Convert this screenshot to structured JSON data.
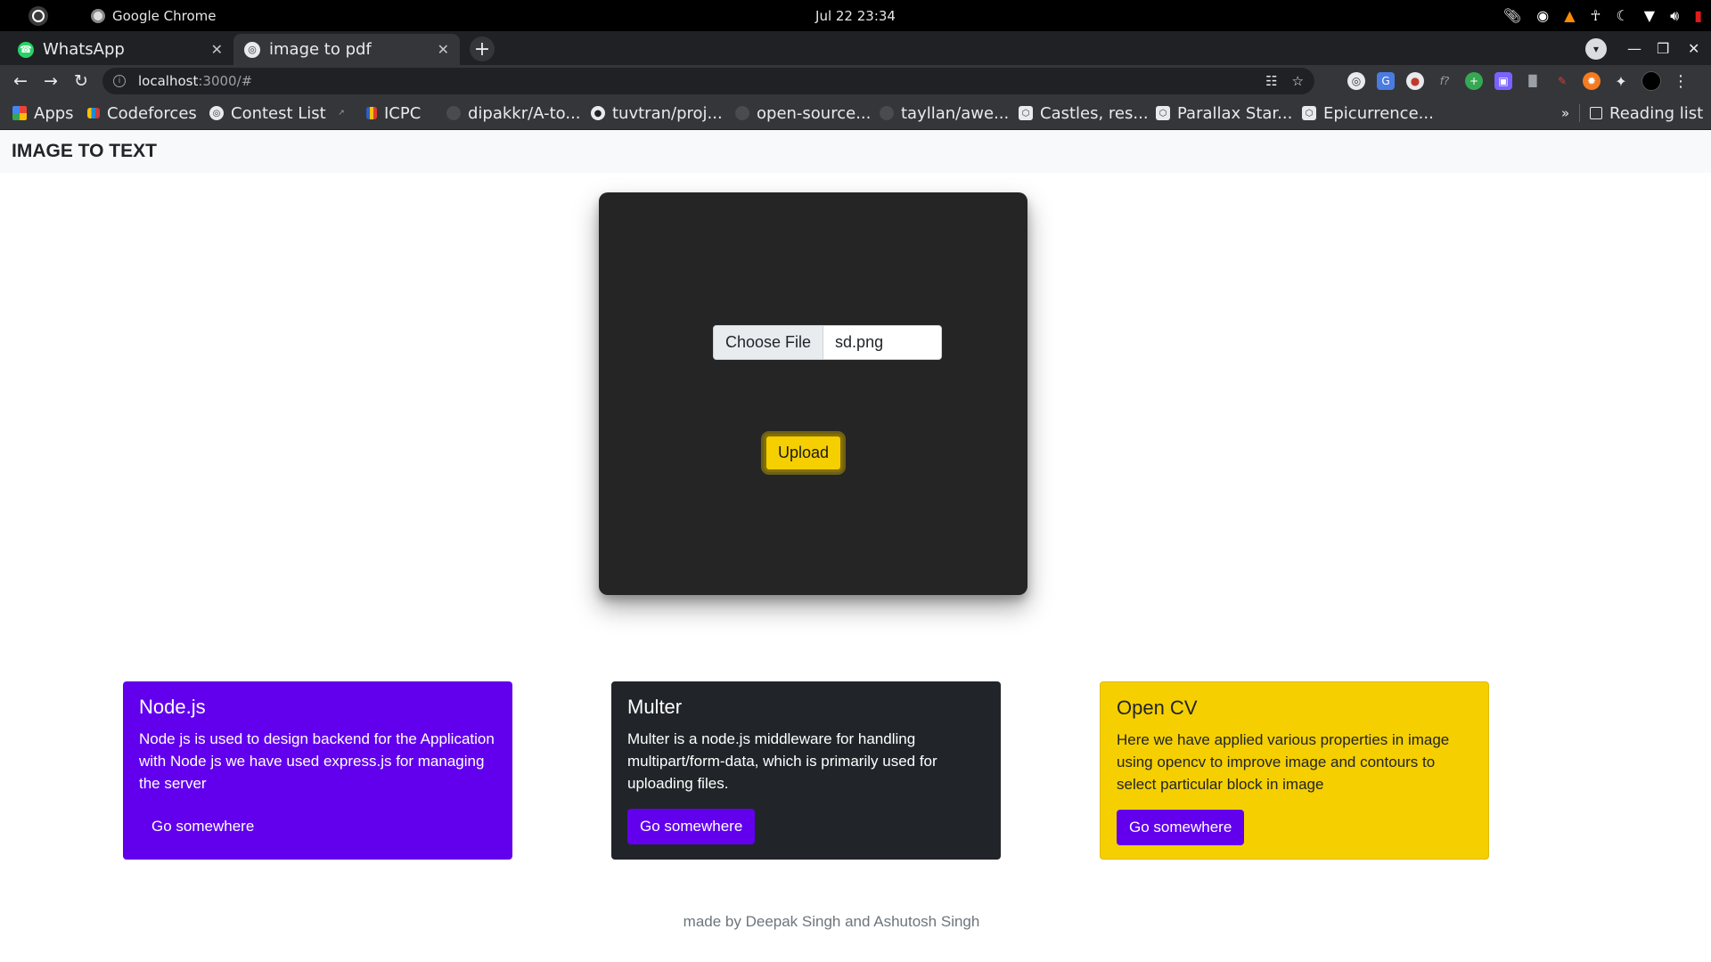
{
  "os": {
    "app_name": "Google Chrome",
    "clock": "Jul 22  23:34",
    "tray_icons": [
      "paperclip-icon",
      "record-icon",
      "vlc-cone-icon",
      "accessibility-icon",
      "night-light-icon",
      "wifi-icon",
      "volume-icon",
      "battery-icon"
    ]
  },
  "tabs": [
    {
      "title": "WhatsApp",
      "active": false,
      "icon": "whatsapp-icon"
    },
    {
      "title": "image to pdf",
      "active": true,
      "icon": "globe-icon"
    }
  ],
  "address": {
    "host": "localhost",
    "path": ":3000/#"
  },
  "bookmarks": [
    {
      "label": "Apps",
      "icon": "apps-grid-icon"
    },
    {
      "label": "Codeforces",
      "icon": "codeforces-icon"
    },
    {
      "label": "Contest List",
      "icon": "globe-icon"
    },
    {
      "label": "",
      "icon": "small-link-icon"
    },
    {
      "label": "ICPC",
      "icon": "icpc-icon"
    },
    {
      "label": "dipakkr/A-to...",
      "icon": "github-icon"
    },
    {
      "label": "tuvtran/proj...",
      "icon": "github-icon"
    },
    {
      "label": "open-source...",
      "icon": "github-icon"
    },
    {
      "label": "tayllan/awe...",
      "icon": "github-icon"
    },
    {
      "label": "Castles, res...",
      "icon": "codepen-icon"
    },
    {
      "label": "Parallax Star...",
      "icon": "codepen-icon"
    },
    {
      "label": "Epicurrence...",
      "icon": "codepen-icon"
    }
  ],
  "bookmarks_overflow": "»",
  "reading_list": "Reading list",
  "page": {
    "brand": "IMAGE TO TEXT",
    "file_button": "Choose File",
    "file_name": "sd.png",
    "upload_label": "Upload",
    "cards": [
      {
        "title": "Node.js",
        "text": "Node js is used to design backend for the Application with Node js we have used express.js for managing the server",
        "button": "Go somewhere"
      },
      {
        "title": "Multer",
        "text": "Multer is a node.js middleware for handling multipart/form-data, which is primarily used for uploading files.",
        "button": "Go somewhere"
      },
      {
        "title": "Open CV",
        "text": "Here we have applied various properties in image using opencv to improve image and contours to select particular block in image",
        "button": "Go somewhere"
      }
    ],
    "footer": "made by Deepak Singh and Ashutosh Singh"
  },
  "colors": {
    "primary_purple": "#6200ee",
    "accent_yellow": "#f5cf00",
    "panel_dark": "#252525",
    "card_dark": "#212529"
  }
}
